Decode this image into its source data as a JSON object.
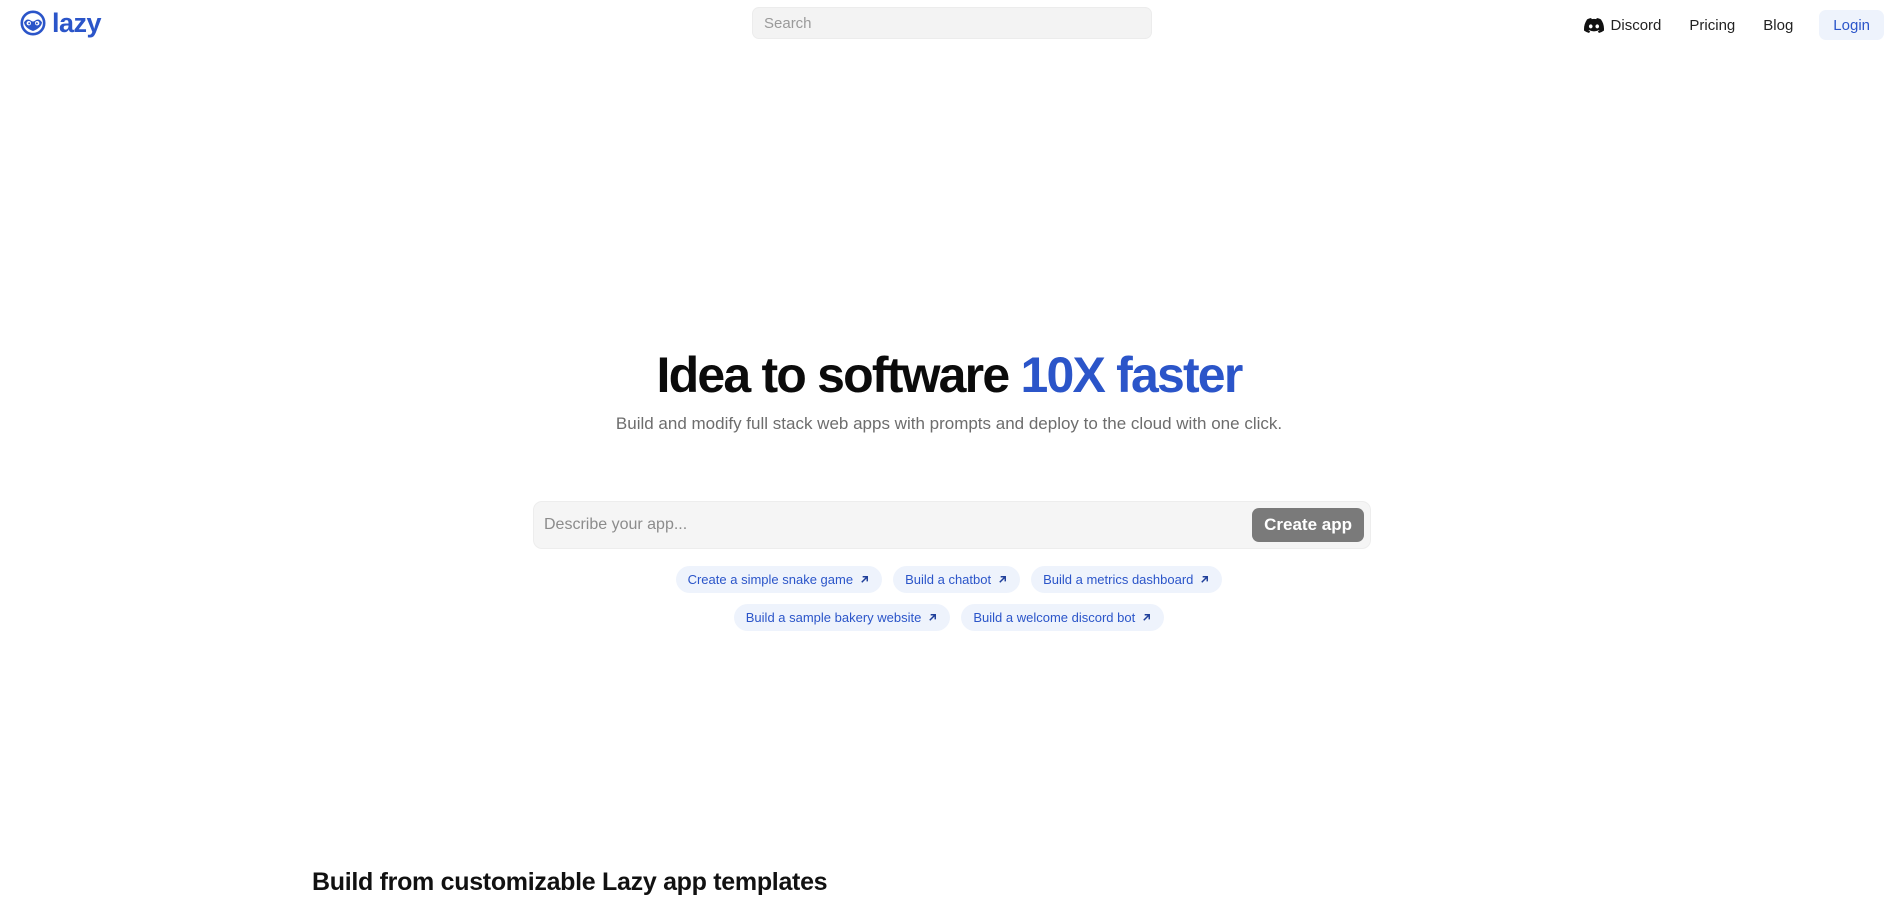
{
  "colors": {
    "accent": "#2b55c9",
    "chip_bg": "#eef3fc",
    "button_gray": "#7a7a7a"
  },
  "header": {
    "logo_text": "lazy",
    "logo_icon": "sloth-face-icon",
    "search": {
      "placeholder": "Search",
      "value": ""
    },
    "nav": {
      "discord": {
        "label": "Discord",
        "icon": "discord-icon"
      },
      "pricing": "Pricing",
      "blog": "Blog",
      "login": "Login"
    }
  },
  "hero": {
    "title_main": "Idea to software ",
    "title_accent": "10X faster",
    "subtitle": "Build and modify full stack web apps with prompts and deploy to the cloud with one click."
  },
  "prompt": {
    "placeholder": "Describe your app...",
    "value": "",
    "button_label": "Create app"
  },
  "suggestions": {
    "row1": [
      "Create a simple snake game",
      "Build a chatbot",
      "Build a metrics dashboard"
    ],
    "row2": [
      "Build a sample bakery website",
      "Build a welcome discord bot"
    ]
  },
  "templates_section": {
    "title": "Build from customizable Lazy app templates"
  }
}
